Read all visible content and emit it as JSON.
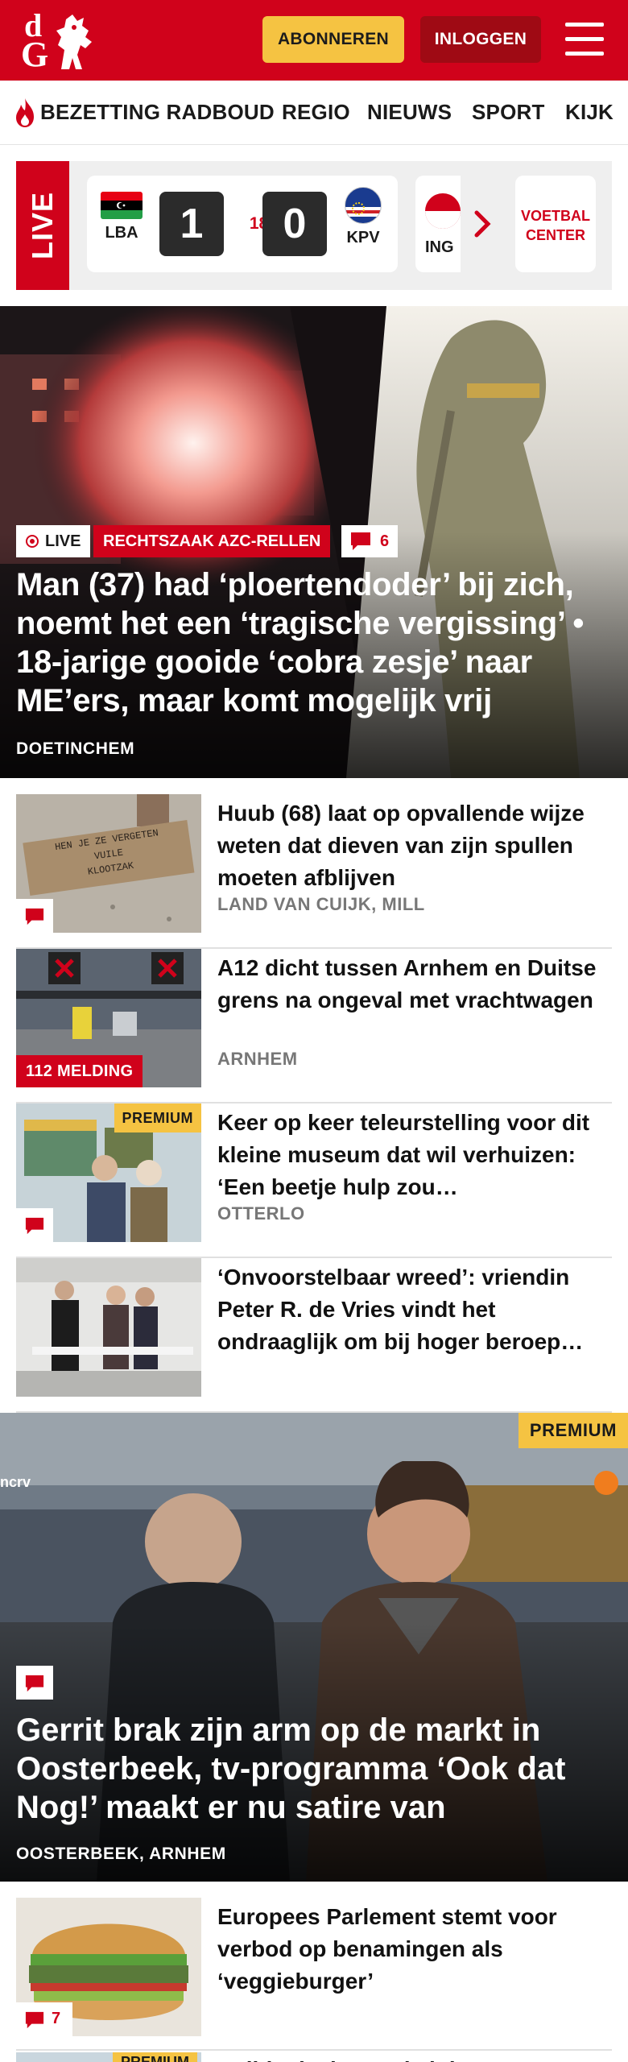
{
  "header": {
    "logo_top": "d",
    "logo_bottom": "G",
    "subscribe_label": "ABONNEREN",
    "login_label": "INLOGGEN"
  },
  "nav": {
    "items": [
      "BEZETTING RADBOUD",
      "REGIO",
      "NIEUWS",
      "SPORT",
      "KIJK"
    ]
  },
  "live": {
    "label": "LIVE",
    "match": {
      "home": "LBA",
      "away": "KPV",
      "home_score": "1",
      "away_score": "0",
      "minute": "18'"
    },
    "next_team": "ING",
    "voetbal_center_line1": "VOETBAL",
    "voetbal_center_line2": "CENTER"
  },
  "hero": {
    "live_tag": "LIVE",
    "topic": "RECHTSZAAK AZC-RELLEN",
    "comments": "6",
    "title": "Man (37) had ‘ploertendoder’ bij zich, noemt het een ‘tragische vergissing’ • 18-jarige gooide ‘cobra zesje’ naar ME’ers, maar komt mogelijk vrij",
    "location": "DOETINCHEM"
  },
  "articles": [
    {
      "title": "Huub (68) laat op opvallende wijze weten dat dieven van zijn spullen moeten afblijven",
      "location": "LAND VAN CUIJK, MILL",
      "sign_line1": "HEN JE ZE VERGETEN",
      "sign_line2": "VUILE",
      "sign_line3": "KLOOTZAK"
    },
    {
      "title": "A12 dicht tussen Arnhem en Duitse grens na ongeval met vrachtwagen",
      "location": "ARNHEM",
      "badge": "112 MELDING"
    },
    {
      "title": "Keer op keer teleurstelling voor dit kleine museum dat wil verhuizen: ‘Een beetje hulp zou…",
      "location": "OTTERLO",
      "premium": "PREMIUM"
    },
    {
      "title": "‘Onvoorstelbaar wreed’: vriendin Peter R. de Vries vindt het ondraaglijk om bij hoger beroep…",
      "location": ""
    }
  ],
  "feature": {
    "premium": "PREMIUM",
    "broadcaster": "ncrv",
    "title": "Gerrit brak zijn arm op de markt in Oosterbeek, tv-programma ‘Ook dat Nog!’ maakt er nu satire van",
    "location": "OOSTERBEEK, ARNHEM"
  },
  "articles2": [
    {
      "title": "Europees Parlement stemt voor verbod op benamingen als ‘veggieburger’",
      "comments": "7"
    },
    {
      "premium": "PREMIUM",
      "title": "Politie deelt met de juiste…"
    }
  ],
  "colors": {
    "brand_red": "#d0021b",
    "dark_red": "#9f0a14",
    "premium_yellow": "#f5c342",
    "live_strip_bg": "#efefef",
    "location_gray": "#777777"
  },
  "icons": [
    "flame-icon",
    "menu-icon",
    "chevron-right-icon",
    "comment-icon",
    "live-dot-icon"
  ]
}
